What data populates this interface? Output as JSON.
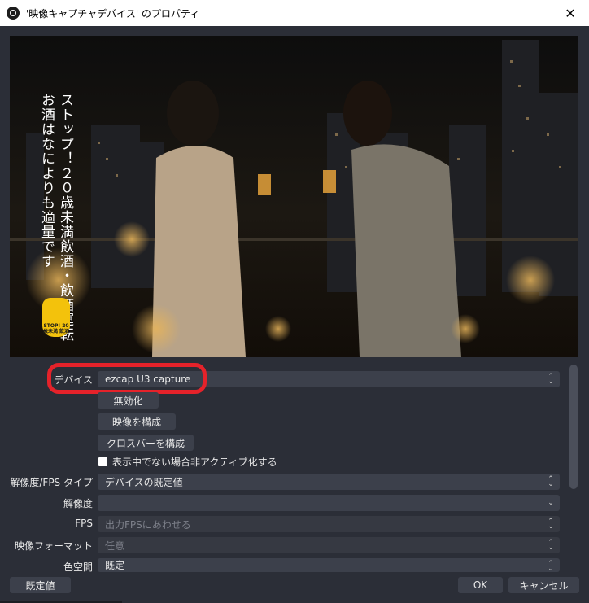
{
  "window": {
    "title": "'映像キャプチャデバイス' のプロパティ",
    "close_glyph": "✕",
    "icon": "obs-logo-icon"
  },
  "preview": {
    "overlay_line1": "ストップ！２０歳未満飲酒・飲酒運転",
    "overlay_line2": "お酒はなによりも適量です",
    "badge_text": "STOP! 20歳未満 飲酒"
  },
  "form": {
    "device": {
      "label": "デバイス",
      "value": "ezcap U3 capture"
    },
    "deactivate_button": "無効化",
    "configure_video_button": "映像を構成",
    "configure_crossbar_button": "クロスバーを構成",
    "deactivate_when_hidden": {
      "label": "表示中でない場合非アクティブ化する",
      "checked": false
    },
    "resolution_fps_type": {
      "label": "解像度/FPS タイプ",
      "value": "デバイスの既定値"
    },
    "resolution": {
      "label": "解像度",
      "value": ""
    },
    "fps": {
      "label": "FPS",
      "value": "出力FPSにあわせる"
    },
    "video_format": {
      "label": "映像フォーマット",
      "value": "任意"
    },
    "color_space": {
      "label": "色空間",
      "value": "既定"
    }
  },
  "footer": {
    "defaults_button": "既定値",
    "ok_button": "OK",
    "cancel_button": "キャンセル"
  },
  "colors": {
    "background": "#2b2e37",
    "field": "#3c404b",
    "highlight": "#e5222a",
    "badge": "#f3c20c"
  }
}
